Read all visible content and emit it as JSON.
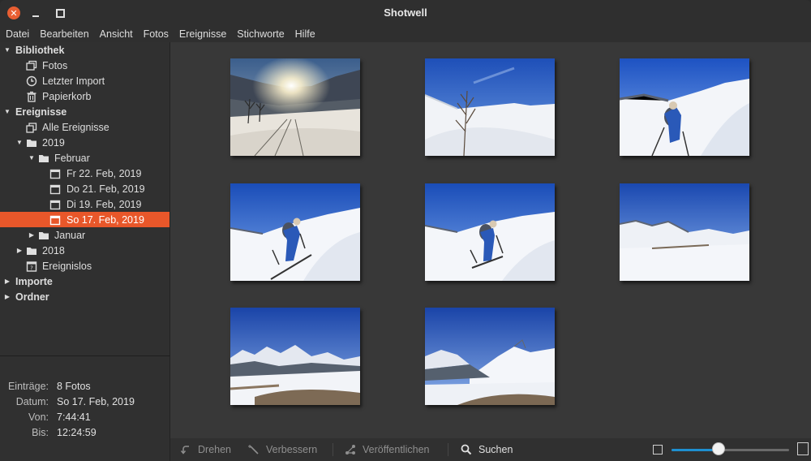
{
  "window": {
    "title": "Shotwell",
    "close_glyph": "✕"
  },
  "menu": [
    "Datei",
    "Bearbeiten",
    "Ansicht",
    "Fotos",
    "Ereignisse",
    "Stichworte",
    "Hilfe"
  ],
  "sidebar": {
    "library": {
      "label": "Bibliothek",
      "items": [
        {
          "label": "Fotos",
          "icon": "photos-icon"
        },
        {
          "label": "Letzter Import",
          "icon": "clock-icon"
        },
        {
          "label": "Papierkorb",
          "icon": "trash-icon"
        }
      ]
    },
    "events": {
      "label": "Ereignisse",
      "all_label": "Alle Ereignisse",
      "year_2019": "2019",
      "month_feb": "Februar",
      "days": [
        {
          "label": "Fr 22. Feb, 2019"
        },
        {
          "label": "Do 21. Feb, 2019"
        },
        {
          "label": "Di 19. Feb, 2019"
        },
        {
          "label": "So 17. Feb, 2019",
          "selected": true
        }
      ],
      "month_jan": "Januar",
      "year_2018": "2018",
      "no_event": "Ereignislos"
    },
    "imports_label": "Importe",
    "folders_label": "Ordner"
  },
  "info": {
    "entries_key": "Einträge:",
    "entries_val": "8 Fotos",
    "date_key": "Datum:",
    "date_val": "So 17. Feb, 2019",
    "from_key": "Von:",
    "from_val": "7:44:41",
    "to_key": "Bis:",
    "to_val": "12:24:59"
  },
  "photos": [
    {
      "scene": "sunrise-valley"
    },
    {
      "scene": "slope-dead-tree"
    },
    {
      "scene": "skier-climbing-near"
    },
    {
      "scene": "skier-climbing-left"
    },
    {
      "scene": "skier-climbing-mid"
    },
    {
      "scene": "ridge-panorama"
    },
    {
      "scene": "mountain-range"
    },
    {
      "scene": "mountain-range-right"
    }
  ],
  "toolbar": {
    "rotate": "Drehen",
    "enhance": "Verbessern",
    "publish": "Veröffentlichen",
    "search": "Suchen",
    "zoom_level": 0.4,
    "accent": "#e8572a",
    "slider_color": "#1e8fd0"
  }
}
